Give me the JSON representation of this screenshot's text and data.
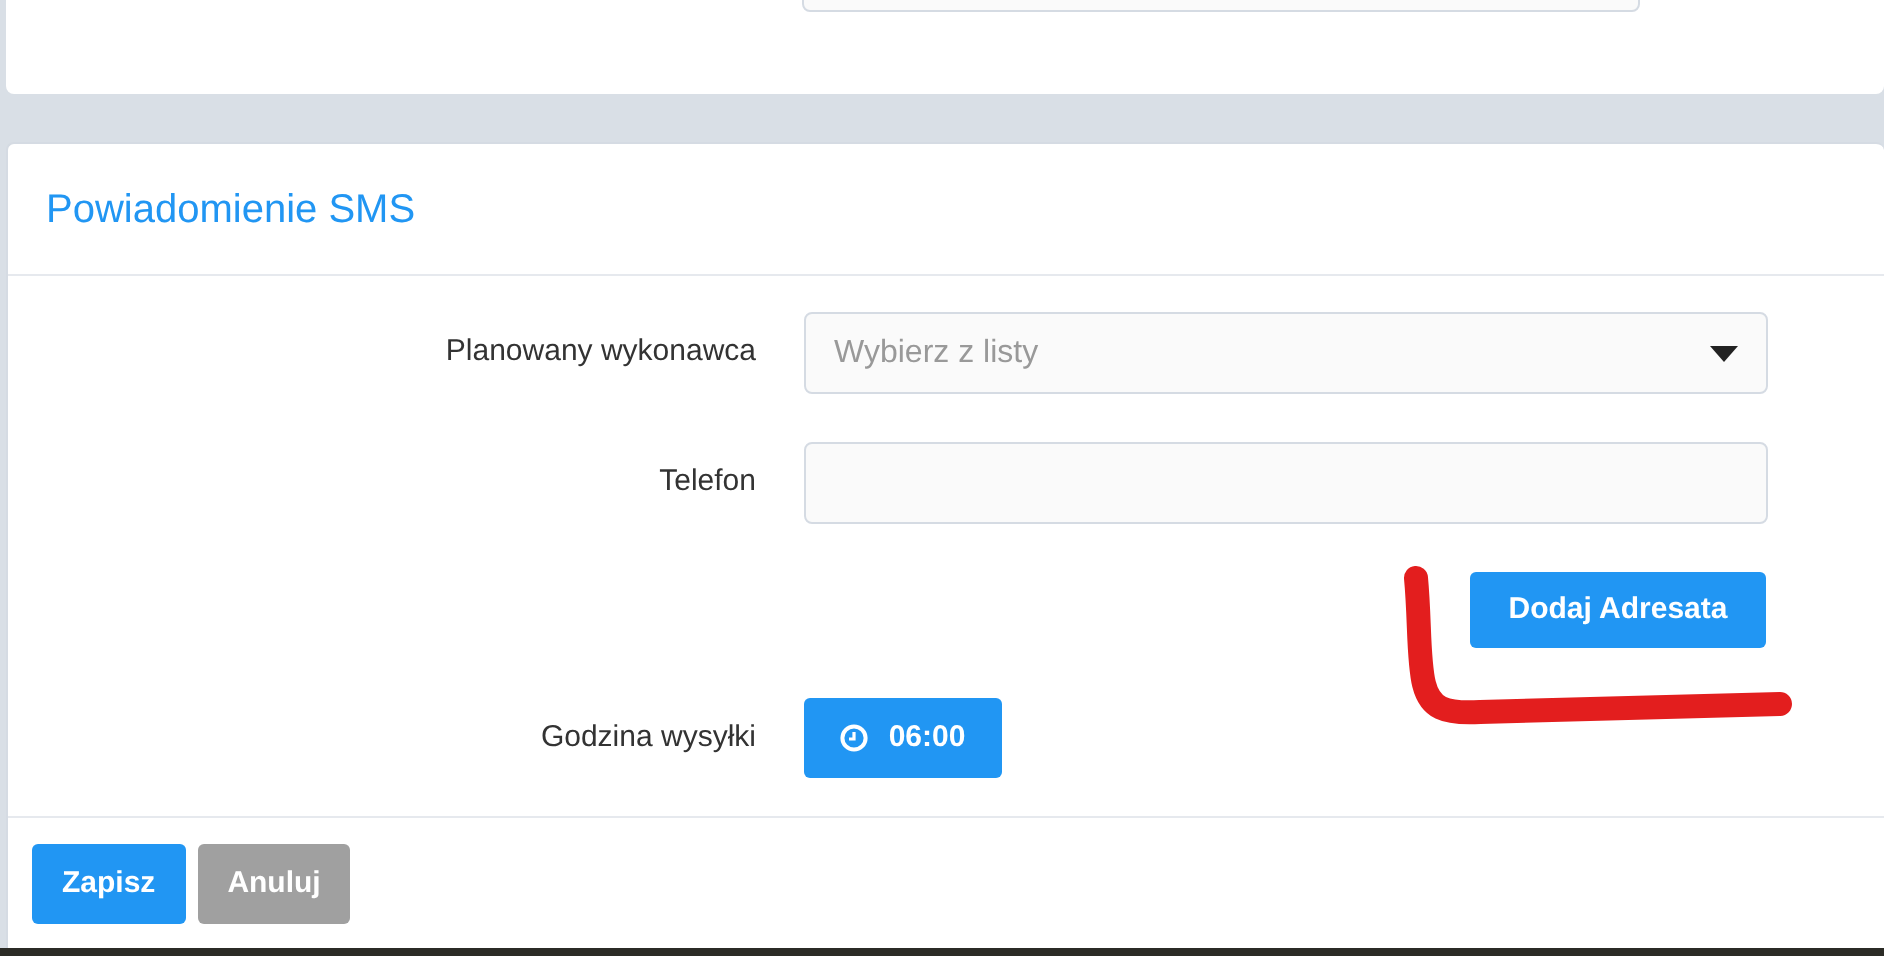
{
  "section": {
    "title": "Powiadomienie SMS"
  },
  "fields": [
    {
      "kind": "select",
      "label": "Planowany wykonawca",
      "placeholder": "Wybierz z listy"
    },
    {
      "kind": "text",
      "label": "Telefon"
    }
  ],
  "add_button": "Dodaj Adresata",
  "send_time": {
    "label": "Godzina wysyłki",
    "value": "06:00"
  },
  "footer_buttons": [
    {
      "label": "Zapisz",
      "kind": "primary"
    },
    {
      "label": "Anuluj",
      "kind": "secondary"
    }
  ]
}
